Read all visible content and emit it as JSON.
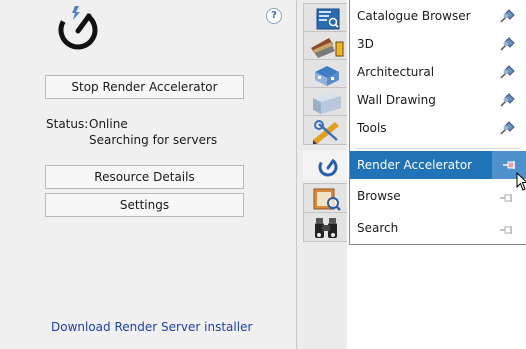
{
  "panel": {
    "help_label": "?",
    "stop_button_label": "Stop Render Accelerator",
    "status_label": "Status:",
    "status_value": "Online",
    "status_sub": "Searching for servers",
    "resource_details_label": "Resource Details",
    "settings_label": "Settings",
    "download_link": "Download Render Server installer"
  },
  "toolbar": {
    "items": [
      {
        "icon": "catalogue-book-icon"
      },
      {
        "icon": "material-swatches-icon"
      },
      {
        "icon": "building-icon"
      },
      {
        "icon": "wall-icon"
      },
      {
        "icon": "tools-icon"
      },
      {
        "icon": "render-accelerator-icon"
      },
      {
        "icon": "browse-picture-icon"
      },
      {
        "icon": "binoculars-icon"
      }
    ]
  },
  "menu": {
    "items": [
      {
        "label": "Catalogue Browser",
        "pinned": true
      },
      {
        "label": "3D",
        "pinned": true
      },
      {
        "label": "Architectural",
        "pinned": true
      },
      {
        "label": "Wall Drawing",
        "pinned": true
      },
      {
        "label": "Tools",
        "pinned": true
      },
      {
        "label": "Render Accelerator",
        "pinned": false,
        "selected": true
      },
      {
        "label": "Browse",
        "pinned": false
      },
      {
        "label": "Search",
        "pinned": false
      }
    ]
  },
  "colors": {
    "selection": "#2173b8",
    "link": "#1f3fa8",
    "logo_accent": "#3a6fb8"
  }
}
